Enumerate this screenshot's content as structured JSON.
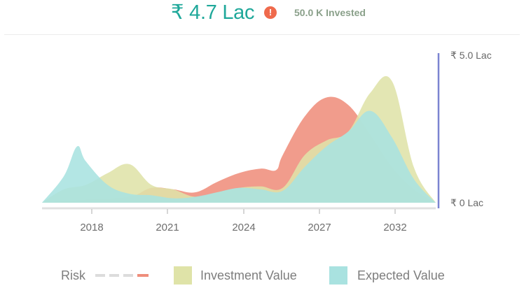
{
  "header": {
    "currency_symbol": "₹",
    "amount": "4.7 Lac",
    "info_icon": "!",
    "invested": "50.0 K Invested"
  },
  "legend": {
    "risk_label": "Risk",
    "investment_label": "Investment Value",
    "expected_label": "Expected Value"
  },
  "colors": {
    "risk": "#ef8e7c",
    "investment": "#dfe3a8",
    "expected": "#a9e2e0",
    "axis": "#7b84d1",
    "amount": "#1fa89a"
  },
  "chart_data": {
    "type": "area",
    "x_ticks": [
      "2018",
      "2021",
      "2024",
      "2027",
      "2032"
    ],
    "y_ticks": [
      "₹ 5.0 Lac",
      "₹ 0 Lac"
    ],
    "ylim": [
      0,
      5
    ],
    "xlim": [
      2016,
      2034
    ],
    "series": [
      {
        "name": "Risk",
        "color": "#ef8e7c",
        "x": [
          2016,
          2018,
          2020,
          2021,
          2022,
          2023,
          2024,
          2025,
          2026,
          2026.7,
          2027,
          2028,
          2029,
          2030,
          2031,
          2032,
          2033,
          2034
        ],
        "values": [
          0,
          0.1,
          0.2,
          0.5,
          0.45,
          0.35,
          0.7,
          1.0,
          1.15,
          1.1,
          1.6,
          2.9,
          3.55,
          3.3,
          2.3,
          1.2,
          0.45,
          0
        ]
      },
      {
        "name": "Investment Value",
        "color": "#dfe3a8",
        "x": [
          2016,
          2017,
          2018,
          2019,
          2020,
          2021,
          2022,
          2023,
          2024,
          2025,
          2026,
          2027,
          2028,
          2029,
          2030,
          2031,
          2032,
          2033,
          2034
        ],
        "values": [
          0,
          0.45,
          0.6,
          1.0,
          1.3,
          0.6,
          0.45,
          0.2,
          0.35,
          0.5,
          0.55,
          0.5,
          1.6,
          2.1,
          2.4,
          3.7,
          4.1,
          1.2,
          0
        ]
      },
      {
        "name": "Expected Value",
        "color": "#a9e2e0",
        "x": [
          2016,
          2017,
          2017.6,
          2018,
          2019,
          2020,
          2021,
          2022,
          2023,
          2024,
          2025,
          2026,
          2027,
          2028,
          2029,
          2030,
          2031,
          2032,
          2033,
          2034
        ],
        "values": [
          0,
          0.9,
          1.9,
          1.4,
          0.6,
          0.3,
          0.25,
          0.15,
          0.2,
          0.35,
          0.5,
          0.45,
          0.4,
          1.2,
          1.9,
          2.4,
          3.1,
          2.2,
          0.8,
          0
        ]
      }
    ],
    "legend_position": "bottom"
  }
}
